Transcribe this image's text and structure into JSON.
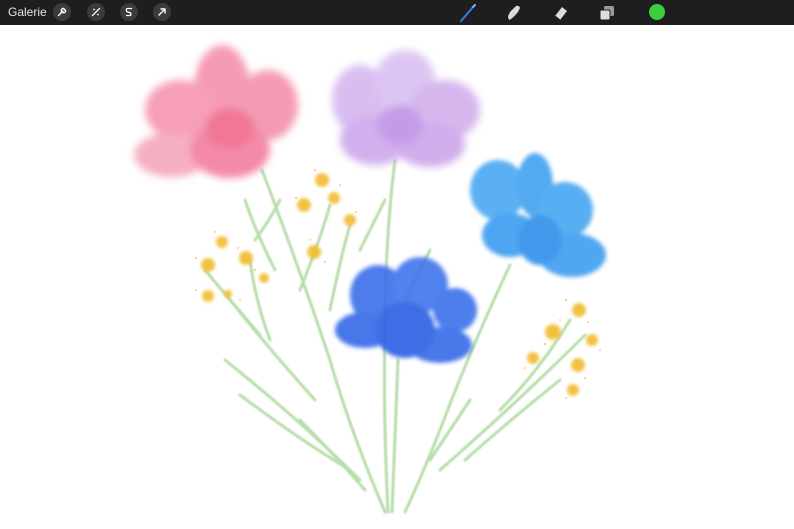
{
  "toolbar": {
    "gallery_label": "Galerie",
    "left_tools": [
      {
        "name": "wrench-icon"
      },
      {
        "name": "adjustments-icon"
      },
      {
        "name": "selection-icon"
      },
      {
        "name": "transform-icon"
      }
    ],
    "right_tools": [
      {
        "name": "brush-icon",
        "active": true
      },
      {
        "name": "smudge-icon"
      },
      {
        "name": "eraser-icon"
      },
      {
        "name": "layers-icon"
      }
    ],
    "current_color": "#3ccf3c",
    "accent_color": "#2f7fe6"
  },
  "artwork": {
    "flower_colors": {
      "pink": "#f06a8f",
      "lavender": "#c39ae6",
      "sky_blue": "#3a9cf0",
      "royal_blue": "#2f63e6",
      "yellow_sprigs": "#f2bb2e",
      "stems": "#9fd38f"
    }
  }
}
